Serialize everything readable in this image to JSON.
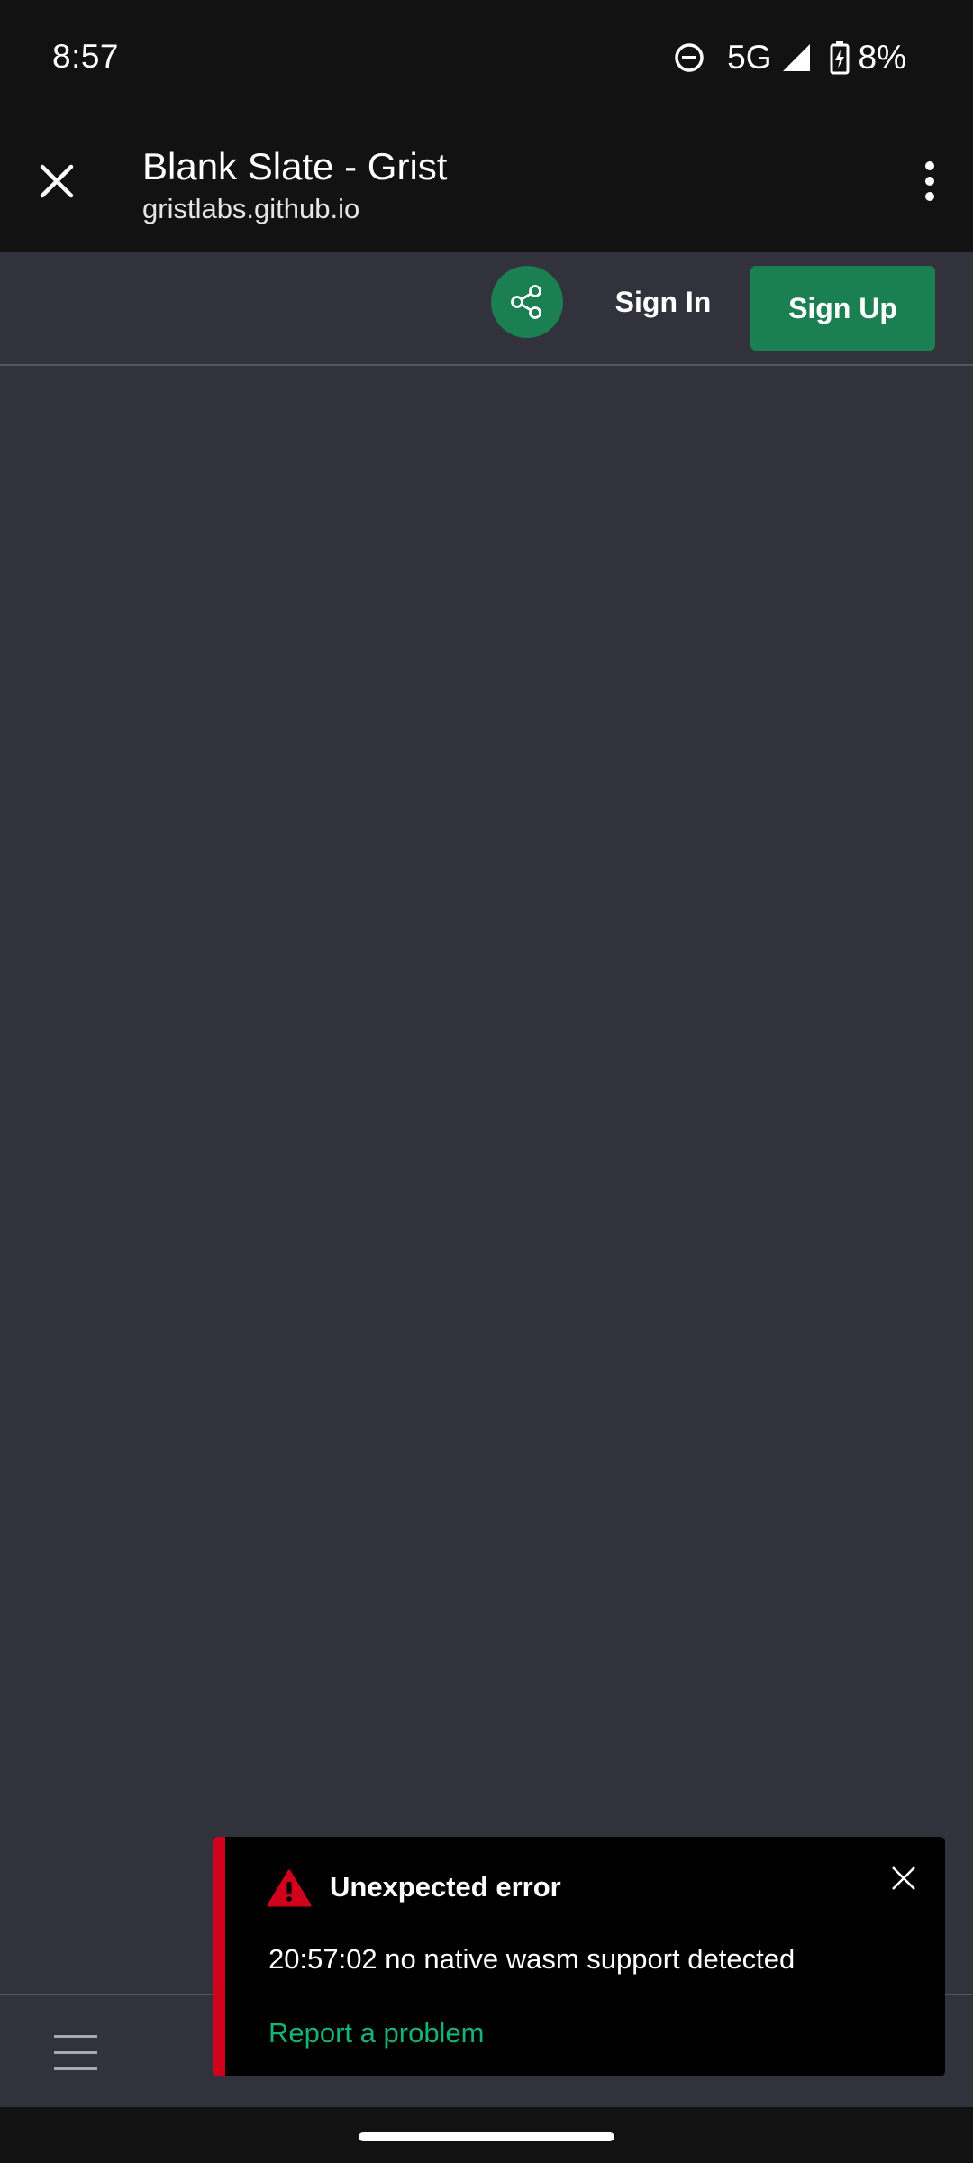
{
  "status_bar": {
    "time": "8:57",
    "network": "5G",
    "battery": "8%",
    "icons": [
      "do-not-disturb-icon",
      "signal-icon",
      "battery-charging-icon"
    ]
  },
  "browser": {
    "page_title": "Blank Slate - Grist",
    "url": "gristlabs.github.io",
    "icons": [
      "close-icon",
      "more-vert-icon"
    ]
  },
  "header": {
    "share_icon": "share-icon",
    "sign_in_label": "Sign In",
    "sign_up_label": "Sign Up"
  },
  "bottom_bar": {
    "menu_icon": "hamburger-menu-icon"
  },
  "toast": {
    "title": "Unexpected error",
    "message": "20:57:02 no native wasm support detected",
    "link": "Report a problem",
    "icons": [
      "warning-icon",
      "close-icon"
    ]
  },
  "colors": {
    "accent_green": "#1a7f51",
    "link_green": "#16b378",
    "error_red": "#d0021b",
    "background": "#32323d",
    "system_bar": "#121212"
  }
}
